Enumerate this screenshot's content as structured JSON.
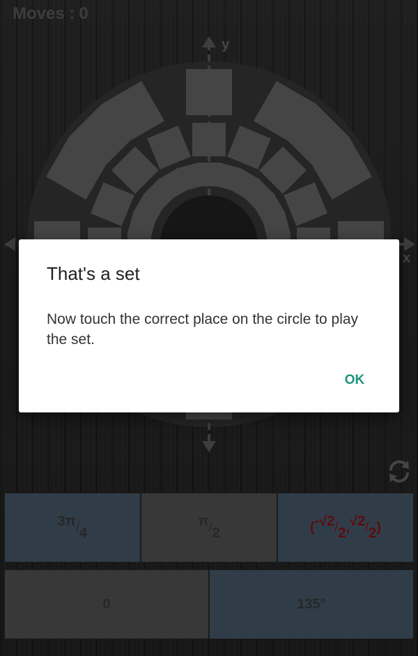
{
  "header": {
    "moves_label": "Moves :",
    "moves_value": "0"
  },
  "axes": {
    "y_label": "y",
    "x_label": "x"
  },
  "answers": {
    "row1": [
      {
        "sup": "3π",
        "sub": "4",
        "style": "blue"
      },
      {
        "sup": "π",
        "sub": "2",
        "style": "grey"
      },
      {
        "text": "(-√2/2,√2/2)",
        "style": "blue",
        "parts": [
          "(",
          "-√2",
          "2",
          ",",
          "√2",
          "2",
          ")"
        ]
      }
    ],
    "row2": [
      {
        "text": "0",
        "style": "grey"
      },
      {
        "text": "135°",
        "style": "blue"
      }
    ]
  },
  "dialog": {
    "title": "That's a set",
    "message": "Now touch the correct place on the circle to play the set.",
    "ok_label": "OK"
  },
  "colors": {
    "tile": "#6a6a6a",
    "accent_ok": "#1a9479",
    "answer_blue": "#4a5e70",
    "answer_red": "#8f1212"
  },
  "icons": {
    "refresh": "refresh-icon"
  }
}
